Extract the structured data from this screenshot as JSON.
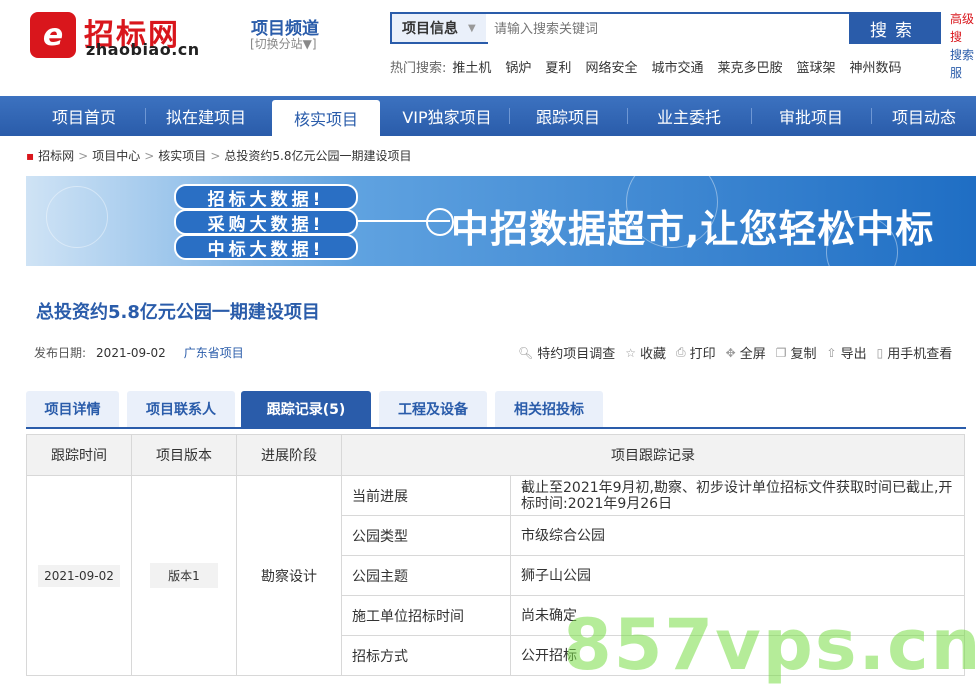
{
  "header": {
    "logo_mark": "e",
    "logo_cn": "招标网",
    "logo_en": "zhaobiao.cn",
    "channel_title": "项目频道",
    "channel_switch": "[切换分站▼]",
    "search_type": "项目信息",
    "search_placeholder": "请输入搜索关键词",
    "search_button": "搜索",
    "right_link_1": "高级搜",
    "right_link_2": "搜索服"
  },
  "hot_search": {
    "label": "热门搜索:",
    "items": [
      "推土机",
      "锅炉",
      "夏利",
      "网络安全",
      "城市交通",
      "莱克多巴胺",
      "篮球架",
      "神州数码"
    ]
  },
  "nav": {
    "items": [
      "项目首页",
      "拟在建项目",
      "核实项目",
      "VIP独家项目",
      "跟踪项目",
      "业主委托",
      "审批项目",
      "项目动态"
    ],
    "active_index": 2
  },
  "breadcrumb": [
    "招标网",
    "项目中心",
    "核实项目",
    "总投资约5.8亿元公园一期建设项目"
  ],
  "banner": {
    "pills": [
      "招标大数据!",
      "采购大数据!",
      "中标大数据!"
    ],
    "slogan": "中招数据超市,让您轻松中标"
  },
  "project": {
    "title": "总投资约5.8亿元公园一期建设项目",
    "pubdate_label": "发布日期:",
    "pubdate": "2021-09-02",
    "area": "广东省项目",
    "tools": [
      "特约项目调查",
      "收藏",
      "打印",
      "全屏",
      "复制",
      "导出",
      "用手机查看"
    ]
  },
  "tabs": [
    "项目详情",
    "项目联系人",
    "跟踪记录(5)",
    "工程及设备",
    "相关招投标"
  ],
  "table": {
    "headers": [
      "跟踪时间",
      "项目版本",
      "进展阶段",
      "项目跟踪记录"
    ],
    "date": "2021-09-02",
    "version": "版本1",
    "stage": "勘察设计",
    "rows": [
      {
        "k": "当前进展",
        "v": "截止至2021年9月初,勘察、初步设计单位招标文件获取时间已截止,开标时间:2021年9月26日"
      },
      {
        "k": "公园类型",
        "v": "市级综合公园"
      },
      {
        "k": "公园主题",
        "v": "狮子山公园"
      },
      {
        "k": "施工单位招标时间",
        "v": "尚未确定"
      },
      {
        "k": "招标方式",
        "v": "公开招标"
      }
    ]
  },
  "watermark": "857vps.cn"
}
